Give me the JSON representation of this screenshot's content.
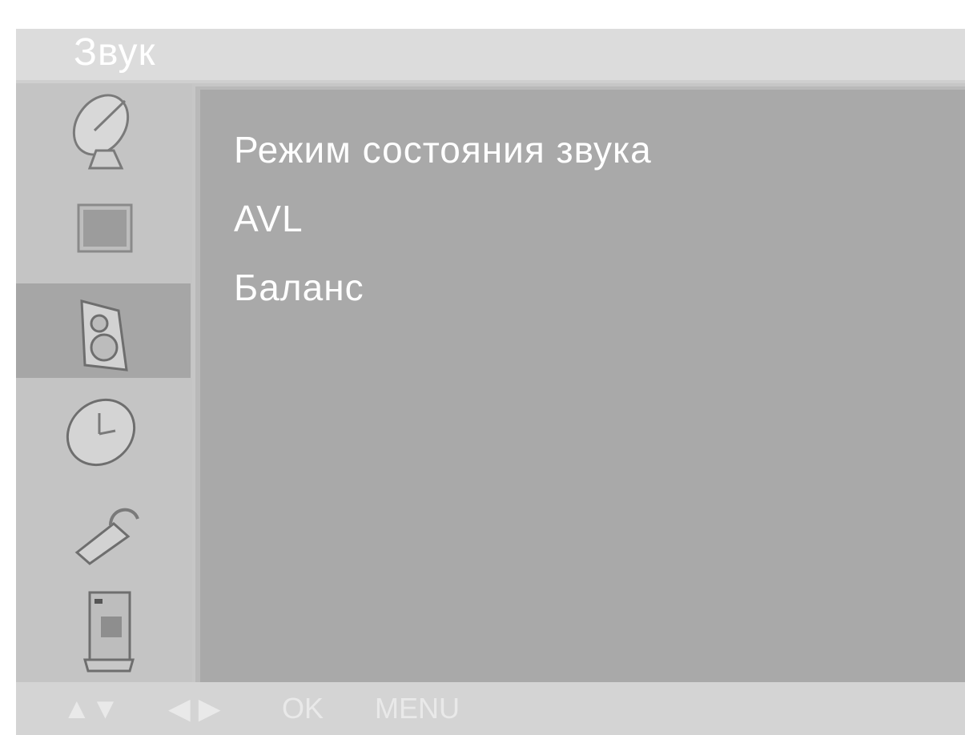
{
  "title": "Звук",
  "sidebar": {
    "items": [
      {
        "icon": "satellite-dish-icon",
        "selected": false
      },
      {
        "icon": "picture-screen-icon",
        "selected": false
      },
      {
        "icon": "speaker-icon",
        "selected": true
      },
      {
        "icon": "clock-icon",
        "selected": false
      },
      {
        "icon": "padlock-icon",
        "selected": false
      },
      {
        "icon": "setup-tools-icon",
        "selected": false
      }
    ]
  },
  "menu": {
    "items": [
      {
        "label": "Режим состояния звука"
      },
      {
        "label": "AVL"
      },
      {
        "label": "Баланс"
      }
    ]
  },
  "footer": {
    "updown": "▲▼",
    "leftright": "◀ ▶",
    "ok": "OK",
    "menu": "MENU"
  },
  "colors": {
    "panel": "#a9a9a9",
    "sidebar": "#c4c4c4",
    "selected": "#a6a6a6",
    "text": "#ffffff"
  }
}
